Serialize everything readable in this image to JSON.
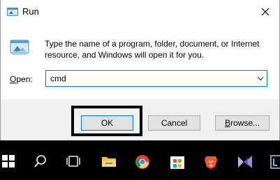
{
  "dialog": {
    "title": "Run",
    "description": "Type the name of a program, folder, document, or Internet resource, and Windows will open it for you.",
    "open_label": "Open:",
    "open_value": "cmd",
    "buttons": {
      "ok": "OK",
      "cancel": "Cancel",
      "browse": "Browse..."
    }
  },
  "colors": {
    "focus": "#0078d7",
    "highlight": "#000000",
    "taskbar": "#000000"
  },
  "taskbar": {
    "icons": [
      "start-icon",
      "search-icon",
      "task-view-icon",
      "file-explorer-icon",
      "chrome-icon",
      "store-icon",
      "brave-icon",
      "visual-studio-icon",
      "app-icon"
    ]
  }
}
